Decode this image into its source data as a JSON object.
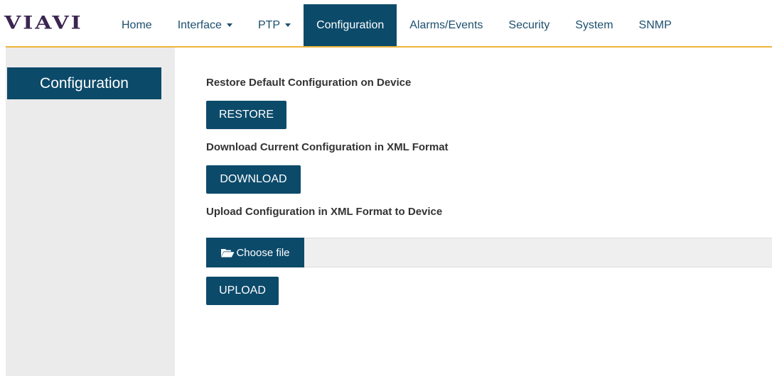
{
  "header": {
    "logo_text": "VIAVI",
    "nav": [
      {
        "label": "Home",
        "dropdown": false
      },
      {
        "label": "Interface",
        "dropdown": true
      },
      {
        "label": "PTP",
        "dropdown": true
      },
      {
        "label": "Configuration",
        "dropdown": false,
        "active": true
      },
      {
        "label": "Alarms/Events",
        "dropdown": false
      },
      {
        "label": "Security",
        "dropdown": false
      },
      {
        "label": "System",
        "dropdown": false
      },
      {
        "label": "SNMP",
        "dropdown": false
      }
    ]
  },
  "sidebar": {
    "items": [
      {
        "label": "Configuration",
        "active": true
      }
    ]
  },
  "main": {
    "restore": {
      "label": "Restore Default Configuration on Device",
      "button": "RESTORE"
    },
    "download": {
      "label": "Download Current Configuration in XML Format",
      "button": "DOWNLOAD"
    },
    "upload": {
      "label": "Upload Configuration in XML Format to Device",
      "choose_file": "Choose file",
      "button": "UPLOAD"
    }
  },
  "colors": {
    "primary": "#0c4a6a",
    "accent_line": "#f0b43a",
    "logo": "#3b2551",
    "sidebar_bg": "#ebebeb"
  },
  "icons": {
    "choose_file": "folder-open-icon",
    "dropdown": "caret-down-icon"
  }
}
